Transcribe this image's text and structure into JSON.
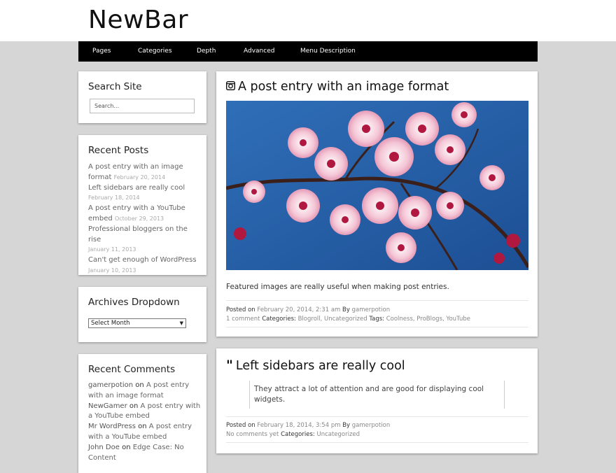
{
  "site": {
    "title": "NewBar"
  },
  "nav": {
    "items": [
      "Pages",
      "Categories",
      "Depth",
      "Advanced",
      "Menu Description"
    ]
  },
  "sidebar": {
    "search": {
      "title": "Search Site",
      "placeholder": "Search..."
    },
    "recent_posts": {
      "title": "Recent Posts",
      "items": [
        {
          "title": "A post entry with an image format",
          "date": "February 20, 2014"
        },
        {
          "title": "Left sidebars are really cool",
          "date": "February 18, 2014"
        },
        {
          "title": "A post entry with a YouTube embed",
          "date": "October 29, 2013"
        },
        {
          "title": "Professional bloggers on the rise",
          "date": "January 11, 2013"
        },
        {
          "title": "Can't get enough of WordPress",
          "date": "January 10, 2013"
        }
      ]
    },
    "archives": {
      "title": "Archives Dropdown",
      "selected": "Select Month"
    },
    "recent_comments": {
      "title": "Recent Comments",
      "items": [
        {
          "author": "gamerpotion",
          "on": "on",
          "post": "A post entry with an image format"
        },
        {
          "author": "NewGamer",
          "on": "on",
          "post": "A post entry with a YouTube embed"
        },
        {
          "author": "Mr WordPress",
          "on": "on",
          "post": "A post entry with a YouTube embed"
        },
        {
          "author": "John Doe",
          "on": "on",
          "post": "Edge Case: No Content"
        }
      ]
    }
  },
  "posts": [
    {
      "format_icon": "camera-icon",
      "title": "A post entry with an image format",
      "excerpt": "Featured images are really useful when making post entries.",
      "posted_on_label": "Posted on",
      "date": "February 20, 2014, 2:31 am",
      "by_label": "By",
      "author": "gamerpotion",
      "comments": "1 comment",
      "categories_label": "Categories:",
      "categories": "Blogroll, Uncategorized",
      "tags_label": "Tags:",
      "tags": "Coolness, ProBlogs, YouTube"
    },
    {
      "format_icon": "quote-icon",
      "title": "Left sidebars are really cool",
      "quote": "They attract a lot of attention and are good for displaying cool widgets.",
      "posted_on_label": "Posted on",
      "date": "February 18, 2014, 3:54 pm",
      "by_label": "By",
      "author": "gamerpotion",
      "comments": "No comments yet",
      "categories_label": "Categories:",
      "categories": "Uncategorized"
    }
  ]
}
